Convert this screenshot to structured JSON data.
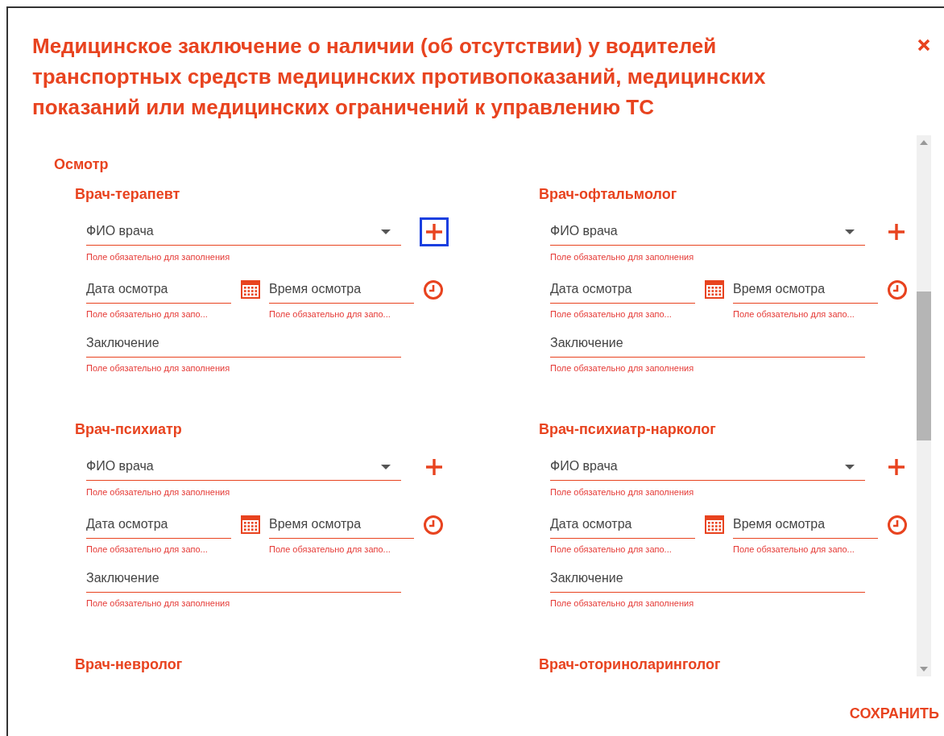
{
  "dialog": {
    "title": "Медицинское заключение о наличии (об отсутствии) у водителей транспортных средств медицинских противопоказаний, медицинских показаний или медицинских ограничений к управлению ТС"
  },
  "section": {
    "title": "Осмотр"
  },
  "doctors": [
    {
      "kind": "full",
      "title": "Врач-терапевт",
      "fio": {
        "placeholder": "ФИО врача",
        "error": "Поле обязательно для заполнения"
      },
      "add_focused": true,
      "date": {
        "placeholder": "Дата осмотра",
        "error": "Поле обязательно для запо..."
      },
      "time": {
        "placeholder": "Время осмотра",
        "error": "Поле обязательно для запо..."
      },
      "conclusion": {
        "placeholder": "Заключение",
        "error": "Поле обязательно для заполнения"
      }
    },
    {
      "kind": "full",
      "title": "Врач-офтальмолог",
      "fio": {
        "placeholder": "ФИО врача",
        "error": "Поле обязательно для заполнения"
      },
      "add_focused": false,
      "date": {
        "placeholder": "Дата осмотра",
        "error": "Поле обязательно для запо..."
      },
      "time": {
        "placeholder": "Время осмотра",
        "error": "Поле обязательно для запо..."
      },
      "conclusion": {
        "placeholder": "Заключение",
        "error": "Поле обязательно для заполнения"
      }
    },
    {
      "kind": "full",
      "title": "Врач-психиатр",
      "fio": {
        "placeholder": "ФИО врача",
        "error": "Поле обязательно для заполнения"
      },
      "add_focused": false,
      "date": {
        "placeholder": "Дата осмотра",
        "error": "Поле обязательно для запо..."
      },
      "time": {
        "placeholder": "Время осмотра",
        "error": "Поле обязательно для запо..."
      },
      "conclusion": {
        "placeholder": "Заключение",
        "error": "Поле обязательно для заполнения"
      }
    },
    {
      "kind": "full",
      "title": "Врач-психиатр-нарколог",
      "fio": {
        "placeholder": "ФИО врача",
        "error": "Поле обязательно для заполнения"
      },
      "add_focused": false,
      "date": {
        "placeholder": "Дата осмотра",
        "error": "Поле обязательно для запо..."
      },
      "time": {
        "placeholder": "Время осмотра",
        "error": "Поле обязательно для запо..."
      },
      "conclusion": {
        "placeholder": "Заключение",
        "error": "Поле обязательно для заполнения"
      }
    },
    {
      "kind": "heading",
      "title": "Врач-невролог"
    },
    {
      "kind": "heading",
      "title": "Врач-оториноларинголог"
    }
  ],
  "save_button": "СОХРАНИТЬ"
}
